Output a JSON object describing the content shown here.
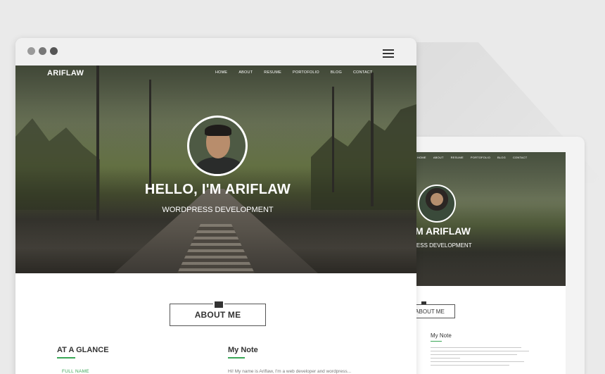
{
  "site": {
    "brand": "ARIFLAW",
    "nav": [
      "HOME",
      "ABOUT",
      "RESUME",
      "PORTOFOLIO",
      "BLOG",
      "CONTACT"
    ],
    "hero_title": "HELLO, I'M ARIFLAW",
    "hero_subtitle": "WORDPRESS DEVELOPMENT"
  },
  "about": {
    "title": "ABOUT ME",
    "glance_title": "AT A GLANCE",
    "glance_label": "FULL NAME",
    "note_title": "My Note",
    "note_text": "Hi! My name is Ariflaw, I'm a web developer and wordpress..."
  },
  "tablet": {
    "hero_title": ", I'M ARIFLAW",
    "hero_subtitle": "RPRESS DEVELOPMENT",
    "about_title": "ABOUT ME",
    "note_title": "My Note"
  },
  "colors": {
    "accent": "#3aa757",
    "text": "#333333"
  },
  "icons": [
    "envelope-icon",
    "hamburger-menu-icon"
  ]
}
